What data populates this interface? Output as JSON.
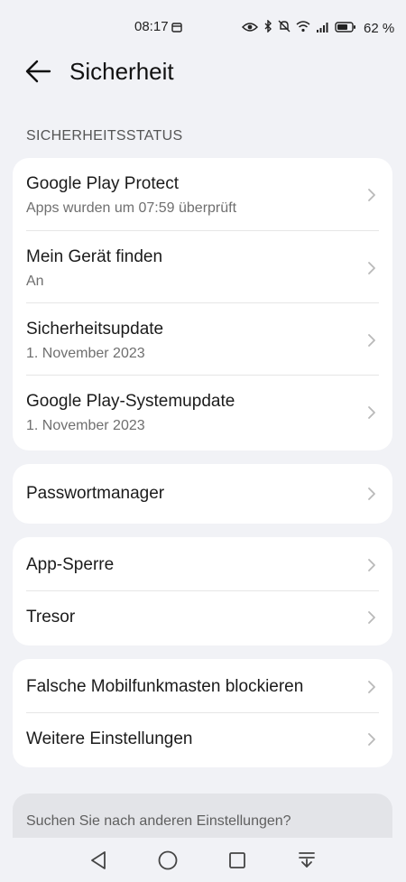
{
  "status_bar": {
    "time": "08:17",
    "battery": "62 %",
    "icons": [
      "calendar-icon",
      "eye-icon",
      "bluetooth-icon",
      "mute-icon",
      "wifi-icon",
      "signal-icon",
      "battery-icon"
    ]
  },
  "header": {
    "title": "Sicherheit",
    "back_icon": "arrow-left-icon"
  },
  "section": {
    "label": "SICHERHEITSSTATUS"
  },
  "status_items": [
    {
      "title": "Google Play Protect",
      "subtitle": "Apps wurden um 07:59 überprüft"
    },
    {
      "title": "Mein Gerät finden",
      "subtitle": "An"
    },
    {
      "title": "Sicherheitsupdate",
      "subtitle": "1. November 2023"
    },
    {
      "title": "Google Play-Systemupdate",
      "subtitle": "1. November 2023"
    }
  ],
  "group2": [
    {
      "title": "Passwortmanager"
    }
  ],
  "group3": [
    {
      "title": "App-Sperre"
    },
    {
      "title": "Tresor"
    }
  ],
  "group4": [
    {
      "title": "Falsche Mobilfunkmasten blockieren"
    },
    {
      "title": "Weitere Einstellungen"
    }
  ],
  "search": {
    "text": "Suchen Sie nach anderen Einstellungen?"
  },
  "nav": [
    "back-triangle-icon",
    "home-circle-icon",
    "recents-square-icon",
    "notification-down-icon"
  ],
  "colors": {
    "background": "#f1f2f6",
    "card": "#ffffff",
    "search_bg": "#e3e4e8"
  }
}
